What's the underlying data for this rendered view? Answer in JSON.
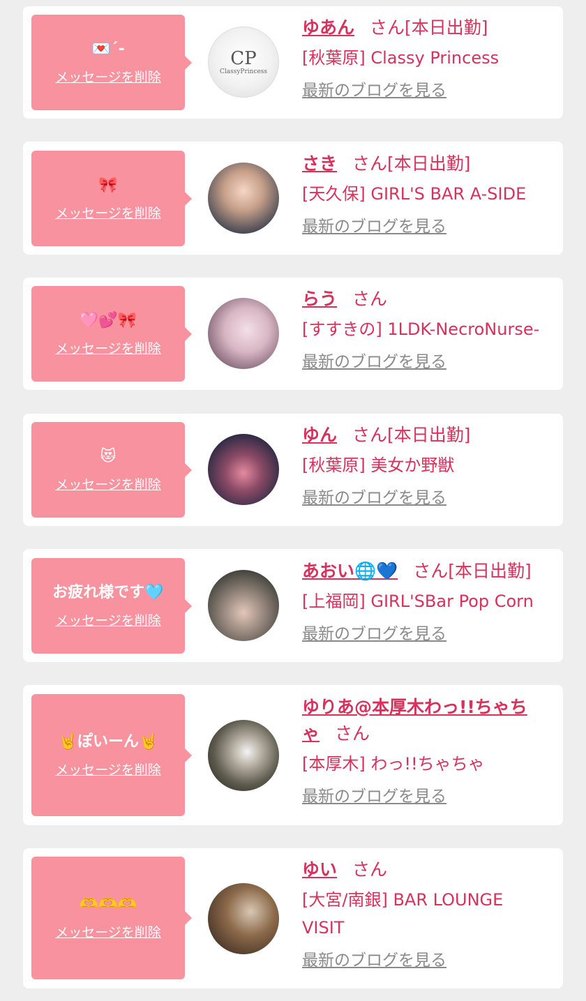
{
  "colors": {
    "accent": "#d6325c",
    "bubble": "#f8929f",
    "background": "#eeeeee"
  },
  "entries": [
    {
      "message": "💌ˊ-",
      "delete_label": "メッセージを削除",
      "name": "ゆあん",
      "suffix": "さん[本日出勤]",
      "shop": "[秋葉原] Classy Princess",
      "blog_label": "最新のブログを見る",
      "avatar_text": "CP",
      "avatar_sub": "ClassyPrincess"
    },
    {
      "message": "🎀",
      "delete_label": "メッセージを削除",
      "name": "さき",
      "suffix": "さん[本日出勤]",
      "shop": "[天久保] GIRL'S BAR A-SIDE",
      "blog_label": "最新のブログを見る"
    },
    {
      "message": "🩷💕🎀",
      "delete_label": "メッセージを削除",
      "name": "らう",
      "suffix": "さん",
      "shop": "[すすきの] 1LDK-NecroNurse-",
      "blog_label": "最新のブログを見る"
    },
    {
      "message": "😻",
      "delete_label": "メッセージを削除",
      "name": "ゆん",
      "suffix": "さん[本日出勤]",
      "shop": "[秋葉原] 美女か野獣",
      "blog_label": "最新のブログを見る"
    },
    {
      "message": "お疲れ様です🩵",
      "delete_label": "メッセージを削除",
      "name": "あおい🌐💙",
      "suffix": "さん[本日出勤]",
      "shop": "[上福岡] GIRL'SBar Pop Corn",
      "blog_label": "最新のブログを見る"
    },
    {
      "message": "🤘ぽいーん🤘",
      "delete_label": "メッセージを削除",
      "name": "ゆりあ@本厚木わっ!!ちゃちゃ",
      "suffix": "さん",
      "shop": "[本厚木] わっ!!ちゃちゃ",
      "blog_label": "最新のブログを見る"
    },
    {
      "message": "🫶🫶🫶",
      "delete_label": "メッセージを削除",
      "name": "ゆい",
      "suffix": "さん",
      "shop": "[大宮/南銀]  BAR LOUNGE VISIT",
      "blog_label": "最新のブログを見る"
    }
  ]
}
